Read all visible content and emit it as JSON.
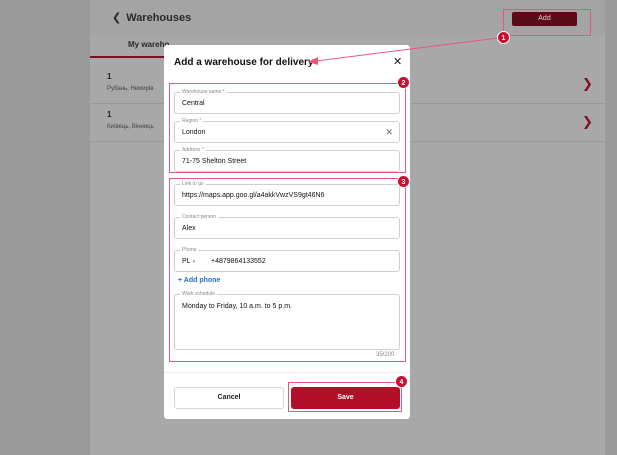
{
  "header": {
    "back_label": "Warehouses",
    "add_label": "Add"
  },
  "tabs": [
    {
      "label": "My wareho"
    },
    {
      "label": ""
    }
  ],
  "rows": [
    {
      "number": "1",
      "address": "Рубань, Немирів"
    },
    {
      "number": "1",
      "address": "Київець, Вінниць"
    }
  ],
  "modal": {
    "title": "Add a warehouse for delivery",
    "close_icon": "close-icon",
    "fields": {
      "warehouse_name": {
        "label": "Warehouse name *",
        "value": "Central"
      },
      "region": {
        "label": "Region *",
        "value": "London"
      },
      "address": {
        "label": "Address *",
        "value": "71-75 Shelton Street"
      },
      "link": {
        "label": "Link to go",
        "value": "https://maps.app.goo.gl/a4akkVwzVS9gt46N6"
      },
      "contact": {
        "label": "Contact person",
        "value": "Alex"
      },
      "phone": {
        "label": "Phone",
        "country": "PL",
        "value": "+4879864133552"
      },
      "schedule": {
        "label": "Work schedule",
        "value": "Monday to Friday, 10 a.m. to 5 p.m.",
        "counter": "35/200"
      }
    },
    "add_phone_label": "+ Add phone",
    "cancel_label": "Cancel",
    "save_label": "Save"
  },
  "annotations": [
    "1",
    "2",
    "3",
    "4"
  ],
  "colors": {
    "accent": "#b30f28",
    "annotation": "#c8102e",
    "link": "#1f6fc8"
  }
}
